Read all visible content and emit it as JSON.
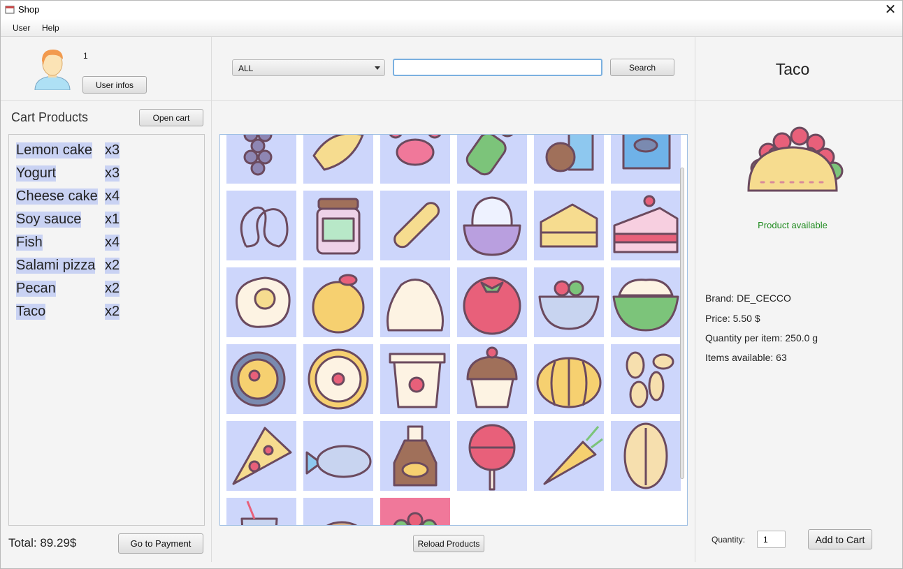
{
  "window": {
    "title": "Shop"
  },
  "menu": {
    "user": "User",
    "help": "Help"
  },
  "user": {
    "id": "1",
    "infos_button": "User infos"
  },
  "filter": {
    "category": "ALL",
    "search_value": "",
    "search_button": "Search"
  },
  "cart": {
    "title": "Cart Products",
    "open_button": "Open cart",
    "items": [
      {
        "name": "Lemon cake",
        "qty": "x3"
      },
      {
        "name": "Yogurt",
        "qty": "x3"
      },
      {
        "name": "Cheese cake",
        "qty": "x4"
      },
      {
        "name": "Soy sauce",
        "qty": "x1"
      },
      {
        "name": "Fish",
        "qty": "x4"
      },
      {
        "name": "Salami pizza",
        "qty": "x2"
      },
      {
        "name": "Pecan",
        "qty": "x2"
      },
      {
        "name": "Taco",
        "qty": "x2"
      }
    ],
    "total": "Total: 89.29$",
    "payment_button": "Go to Payment"
  },
  "products": {
    "reload_button": "Reload Products",
    "tiles": [
      {
        "icon": "grapes-icon"
      },
      {
        "icon": "croissant-icon"
      },
      {
        "icon": "crab-icon"
      },
      {
        "icon": "celery-icon"
      },
      {
        "icon": "coconut-milk-icon"
      },
      {
        "icon": "canned-fish-icon"
      },
      {
        "icon": "pretzel-icon"
      },
      {
        "icon": "jam-jar-icon"
      },
      {
        "icon": "baguette-icon"
      },
      {
        "icon": "mangosteen-icon"
      },
      {
        "icon": "cheese-cake-icon"
      },
      {
        "icon": "cake-slice-icon"
      },
      {
        "icon": "fried-egg-icon"
      },
      {
        "icon": "apple-icon"
      },
      {
        "icon": "flour-sack-icon"
      },
      {
        "icon": "tomato-icon"
      },
      {
        "icon": "salad-bowl-icon"
      },
      {
        "icon": "rice-bowl-icon"
      },
      {
        "icon": "paella-icon"
      },
      {
        "icon": "pizza-icon"
      },
      {
        "icon": "yogurt-icon"
      },
      {
        "icon": "cupcake-icon"
      },
      {
        "icon": "pumpkin-icon"
      },
      {
        "icon": "almonds-icon"
      },
      {
        "icon": "pizza-slice-icon"
      },
      {
        "icon": "fish-icon"
      },
      {
        "icon": "soy-sauce-icon"
      },
      {
        "icon": "lollipop-icon"
      },
      {
        "icon": "carrot-icon"
      },
      {
        "icon": "pecan-icon"
      },
      {
        "icon": "drink-icon"
      },
      {
        "icon": "bread-icon"
      },
      {
        "icon": "taco-icon",
        "selected": true
      }
    ]
  },
  "detail": {
    "name": "Taco",
    "availability": "Product available",
    "brand": "Brand: DE_CECCO",
    "price": "Price: 5.50 $",
    "quantity_per_item": "Quantity per item: 250.0 g",
    "items_available": "Items available: 63",
    "quantity_label": "Quantity:",
    "quantity_value": "1",
    "add_button": "Add to Cart"
  },
  "colors": {
    "tile_bg": "#cdd6fb",
    "selected_tile": "#f0789a",
    "available": "#1e8a1e",
    "highlight": "#c9d2f3"
  }
}
